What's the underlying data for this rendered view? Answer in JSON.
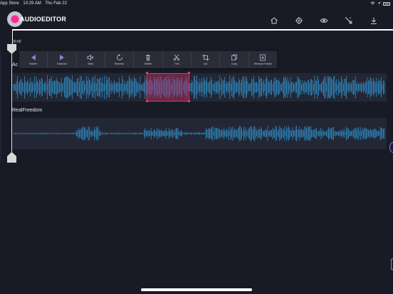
{
  "status_bar": {
    "carrier": "App Store",
    "time": "10:29 AM",
    "date": "Thu Feb 22"
  },
  "app": {
    "logo_text": "AUDIOEDITOR"
  },
  "toolbar": {
    "icons": [
      "home-icon",
      "settings-icon",
      "eye-icon",
      "magic-wand-icon",
      "download-icon"
    ]
  },
  "timeline": {
    "time_label": "00:00"
  },
  "context_menu": {
    "items": [
      {
        "label": "FadeIn",
        "icon": "fade-in-icon"
      },
      {
        "label": "FadeOut",
        "icon": "fade-out-icon"
      },
      {
        "label": "Mute",
        "icon": "mute-icon"
      },
      {
        "label": "Reverse",
        "icon": "reverse-icon"
      },
      {
        "label": "Delete",
        "icon": "trash-icon"
      },
      {
        "label": "Trim",
        "icon": "scissors-icon"
      },
      {
        "label": "Cut",
        "icon": "crop-icon"
      },
      {
        "label": "Copy",
        "icon": "copy-icon"
      },
      {
        "label": "Remove Frame",
        "icon": "remove-frame-icon"
      }
    ]
  },
  "tracks": [
    {
      "name": "Ac",
      "color": "#2f8ec7"
    },
    {
      "name": "RealFreedom",
      "color": "#2f8ec7"
    }
  ],
  "colors": {
    "accent": "#e0336f",
    "waveform": "#2f8ec7",
    "background": "#181b26",
    "track_bg": "#232735"
  }
}
